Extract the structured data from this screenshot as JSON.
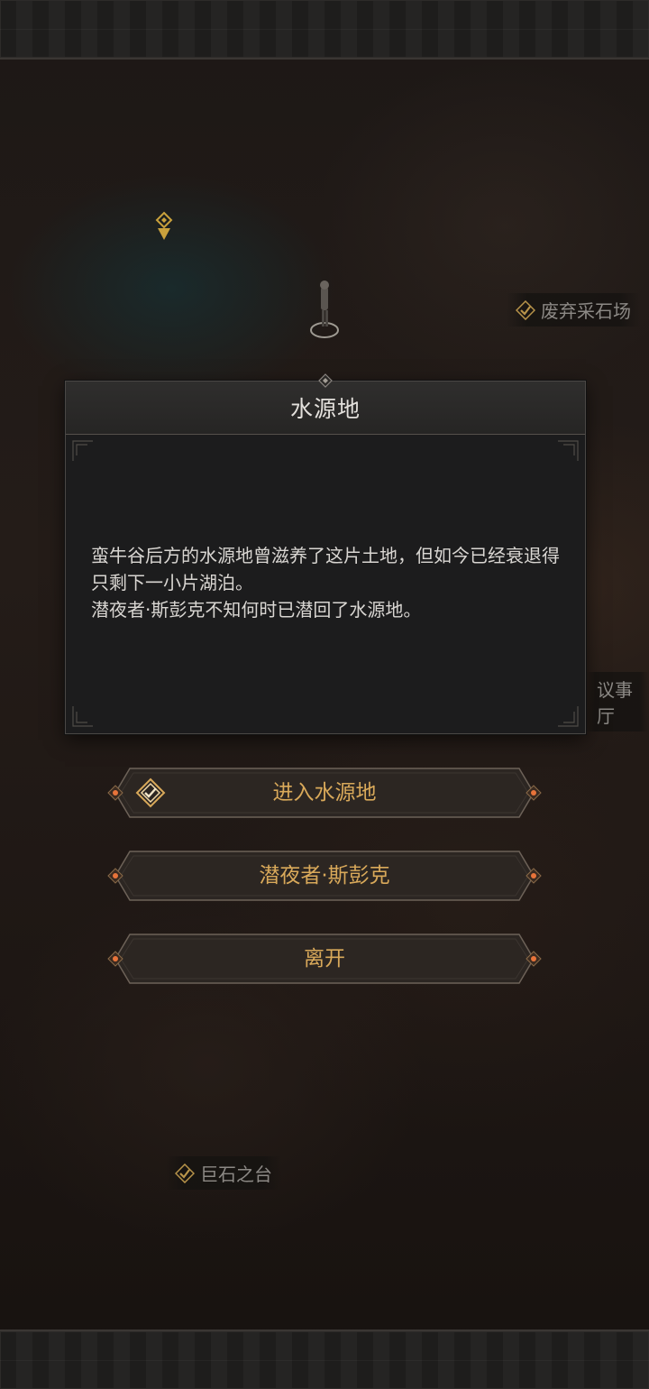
{
  "map": {
    "labels": {
      "quarry": "废弃采石场",
      "hall": "议事厅",
      "stone_platform": "巨石之台"
    }
  },
  "dialog": {
    "title": "水源地",
    "paragraphs": [
      "蛮牛谷后方的水源地曾滋养了这片土地，但如今已经衰退得只剩下一小片湖泊。",
      "潜夜者·斯彭克不知何时已潜回了水源地。"
    ]
  },
  "options": [
    {
      "label": "进入水源地",
      "icon": "quest-diamond-icon"
    },
    {
      "label": "潜夜者·斯彭克"
    },
    {
      "label": "离开"
    }
  ],
  "colors": {
    "accent_gold": "#d9a95a",
    "gem_orange": "#e8743a",
    "check_gold": "#b8944a"
  }
}
